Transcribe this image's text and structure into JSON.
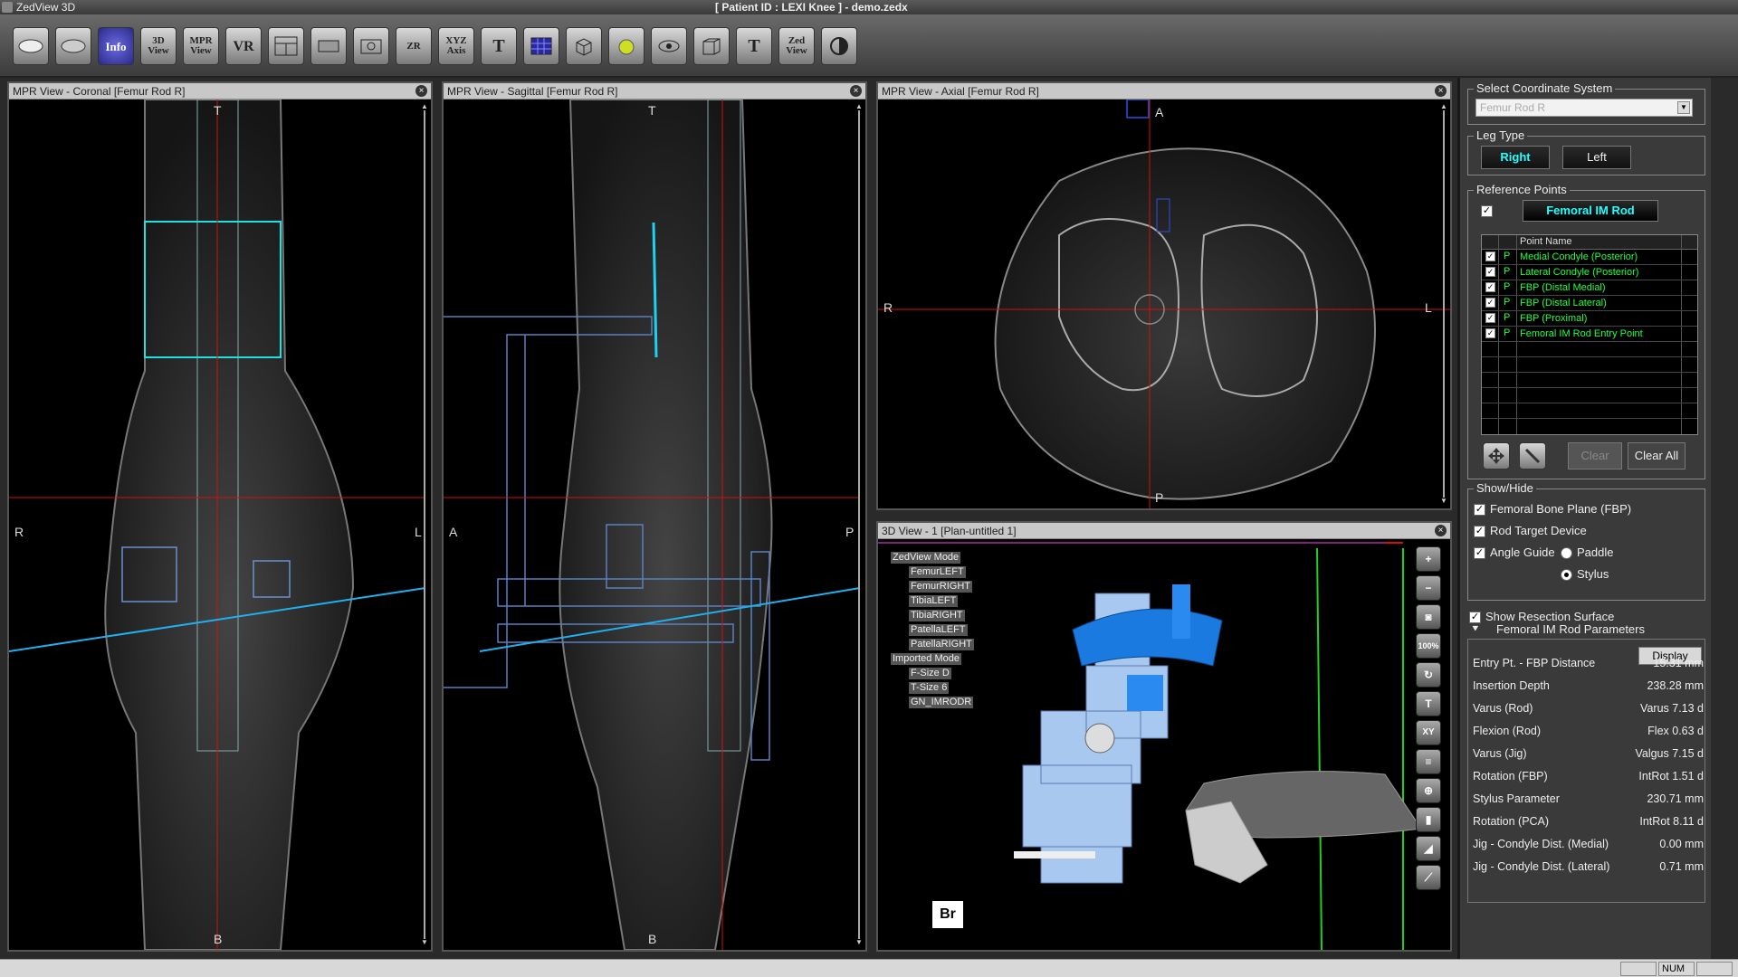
{
  "title_bar": {
    "app": "ZedView 3D",
    "document": "[ Patient ID : LEXI Knee ]  - demo.zedx"
  },
  "toolbar": {
    "buttons": [
      {
        "name": "open-icon",
        "label": ""
      },
      {
        "name": "save-icon",
        "label": ""
      },
      {
        "name": "info-icon",
        "label": "Info"
      },
      {
        "name": "3d-view-icon",
        "label": "3D View"
      },
      {
        "name": "mpr-view-icon",
        "label": "MPR View"
      },
      {
        "name": "vr-icon",
        "label": "VR"
      },
      {
        "name": "layout-icon",
        "label": ""
      },
      {
        "name": "volume-icon",
        "label": ""
      },
      {
        "name": "screenshot-icon",
        "label": ""
      },
      {
        "name": "zoom-icon",
        "label": "ZR"
      },
      {
        "name": "xyz-axis-icon",
        "label": "XYZ Axis"
      },
      {
        "name": "text-icon",
        "label": "T"
      },
      {
        "name": "grid-icon",
        "label": ""
      },
      {
        "name": "cube-icon",
        "label": ""
      },
      {
        "name": "light-icon",
        "label": ""
      },
      {
        "name": "eye-icon",
        "label": ""
      },
      {
        "name": "box-icon",
        "label": ""
      },
      {
        "name": "font-icon",
        "label": "T"
      },
      {
        "name": "zed-view-icon",
        "label": "Zed View"
      },
      {
        "name": "half-circle-icon",
        "label": ""
      }
    ]
  },
  "panels": {
    "coronal": {
      "title": "MPR View - Coronal [Femur Rod R]",
      "labels": {
        "top": "T",
        "bottom": "B",
        "left": "R",
        "right": "L"
      }
    },
    "sagittal": {
      "title": "MPR View - Sagittal [Femur Rod R]",
      "labels": {
        "top": "T",
        "bottom": "B",
        "left": "A",
        "right": "P"
      }
    },
    "axial": {
      "title": "MPR View - Axial [Femur Rod R]",
      "labels": {
        "top": "A",
        "bottom": "P",
        "left": "R",
        "right": "L"
      }
    },
    "view3d": {
      "title": "3D View - 1 [Plan-untitled 1]",
      "tree": [
        "ZedView Mode",
        "FemurLEFT",
        "FemurRIGHT",
        "TibiaLEFT",
        "TibiaRIGHT",
        "PatellaLEFT",
        "PatellaRIGHT",
        "Imported Mode",
        "F-Size D",
        "T-Size 6",
        "GN_IMRODR"
      ],
      "tools": [
        "+",
        "−",
        "◙",
        "100%",
        "↻",
        "T",
        "XY",
        "≡",
        "⊕",
        "▮",
        "◢",
        "⟋"
      ],
      "cube_label": "Br"
    }
  },
  "side": {
    "coord_system": {
      "title": "Select Coordinate System",
      "value": "Femur Rod R"
    },
    "leg_type": {
      "title": "Leg Type",
      "right": "Right",
      "left": "Left"
    },
    "reference_points": {
      "title": "Reference Points",
      "button": "Femoral IM Rod",
      "column_header": "Point Name",
      "rows": [
        {
          "flag": "P",
          "name": "Medial Condyle (Posterior)"
        },
        {
          "flag": "P",
          "name": "Lateral Condyle (Posterior)"
        },
        {
          "flag": "P",
          "name": "FBP (Distal Medial)"
        },
        {
          "flag": "P",
          "name": "FBP (Distal Lateral)"
        },
        {
          "flag": "P",
          "name": "FBP (Proximal)"
        },
        {
          "flag": "P",
          "name": "Femoral IM Rod Entry Point"
        }
      ],
      "clear": "Clear",
      "clear_all": "Clear All"
    },
    "show_hide": {
      "title": "Show/Hide",
      "fbp": "Femoral Bone Plane (FBP)",
      "rod_target": "Rod Target Device",
      "angle_guide": "Angle Guide",
      "paddle": "Paddle",
      "stylus": "Stylus",
      "show_resection": "Show Resection Surface"
    },
    "params": {
      "title": "Femoral IM Rod Parameters",
      "display": "Display",
      "rows": [
        {
          "k": "Entry Pt. - FBP Distance",
          "v": "15.31 mm"
        },
        {
          "k": "Insertion Depth",
          "v": "238.28 mm"
        },
        {
          "k": "Varus (Rod)",
          "v": "Varus 7.13 d"
        },
        {
          "k": "Flexion (Rod)",
          "v": "Flex 0.63 d"
        },
        {
          "k": "Varus (Jig)",
          "v": "Valgus 7.15 d"
        },
        {
          "k": "Rotation (FBP)",
          "v": "IntRot 1.51 d"
        },
        {
          "k": "Stylus Parameter",
          "v": "230.71 mm"
        },
        {
          "k": "Rotation (PCA)",
          "v": "IntRot 8.11 d"
        },
        {
          "k": "Jig - Condyle Dist. (Medial)",
          "v": "0.00 mm"
        },
        {
          "k": "Jig - Condyle Dist. (Lateral)",
          "v": "0.71 mm"
        }
      ]
    }
  },
  "status": {
    "num": "NUM"
  }
}
